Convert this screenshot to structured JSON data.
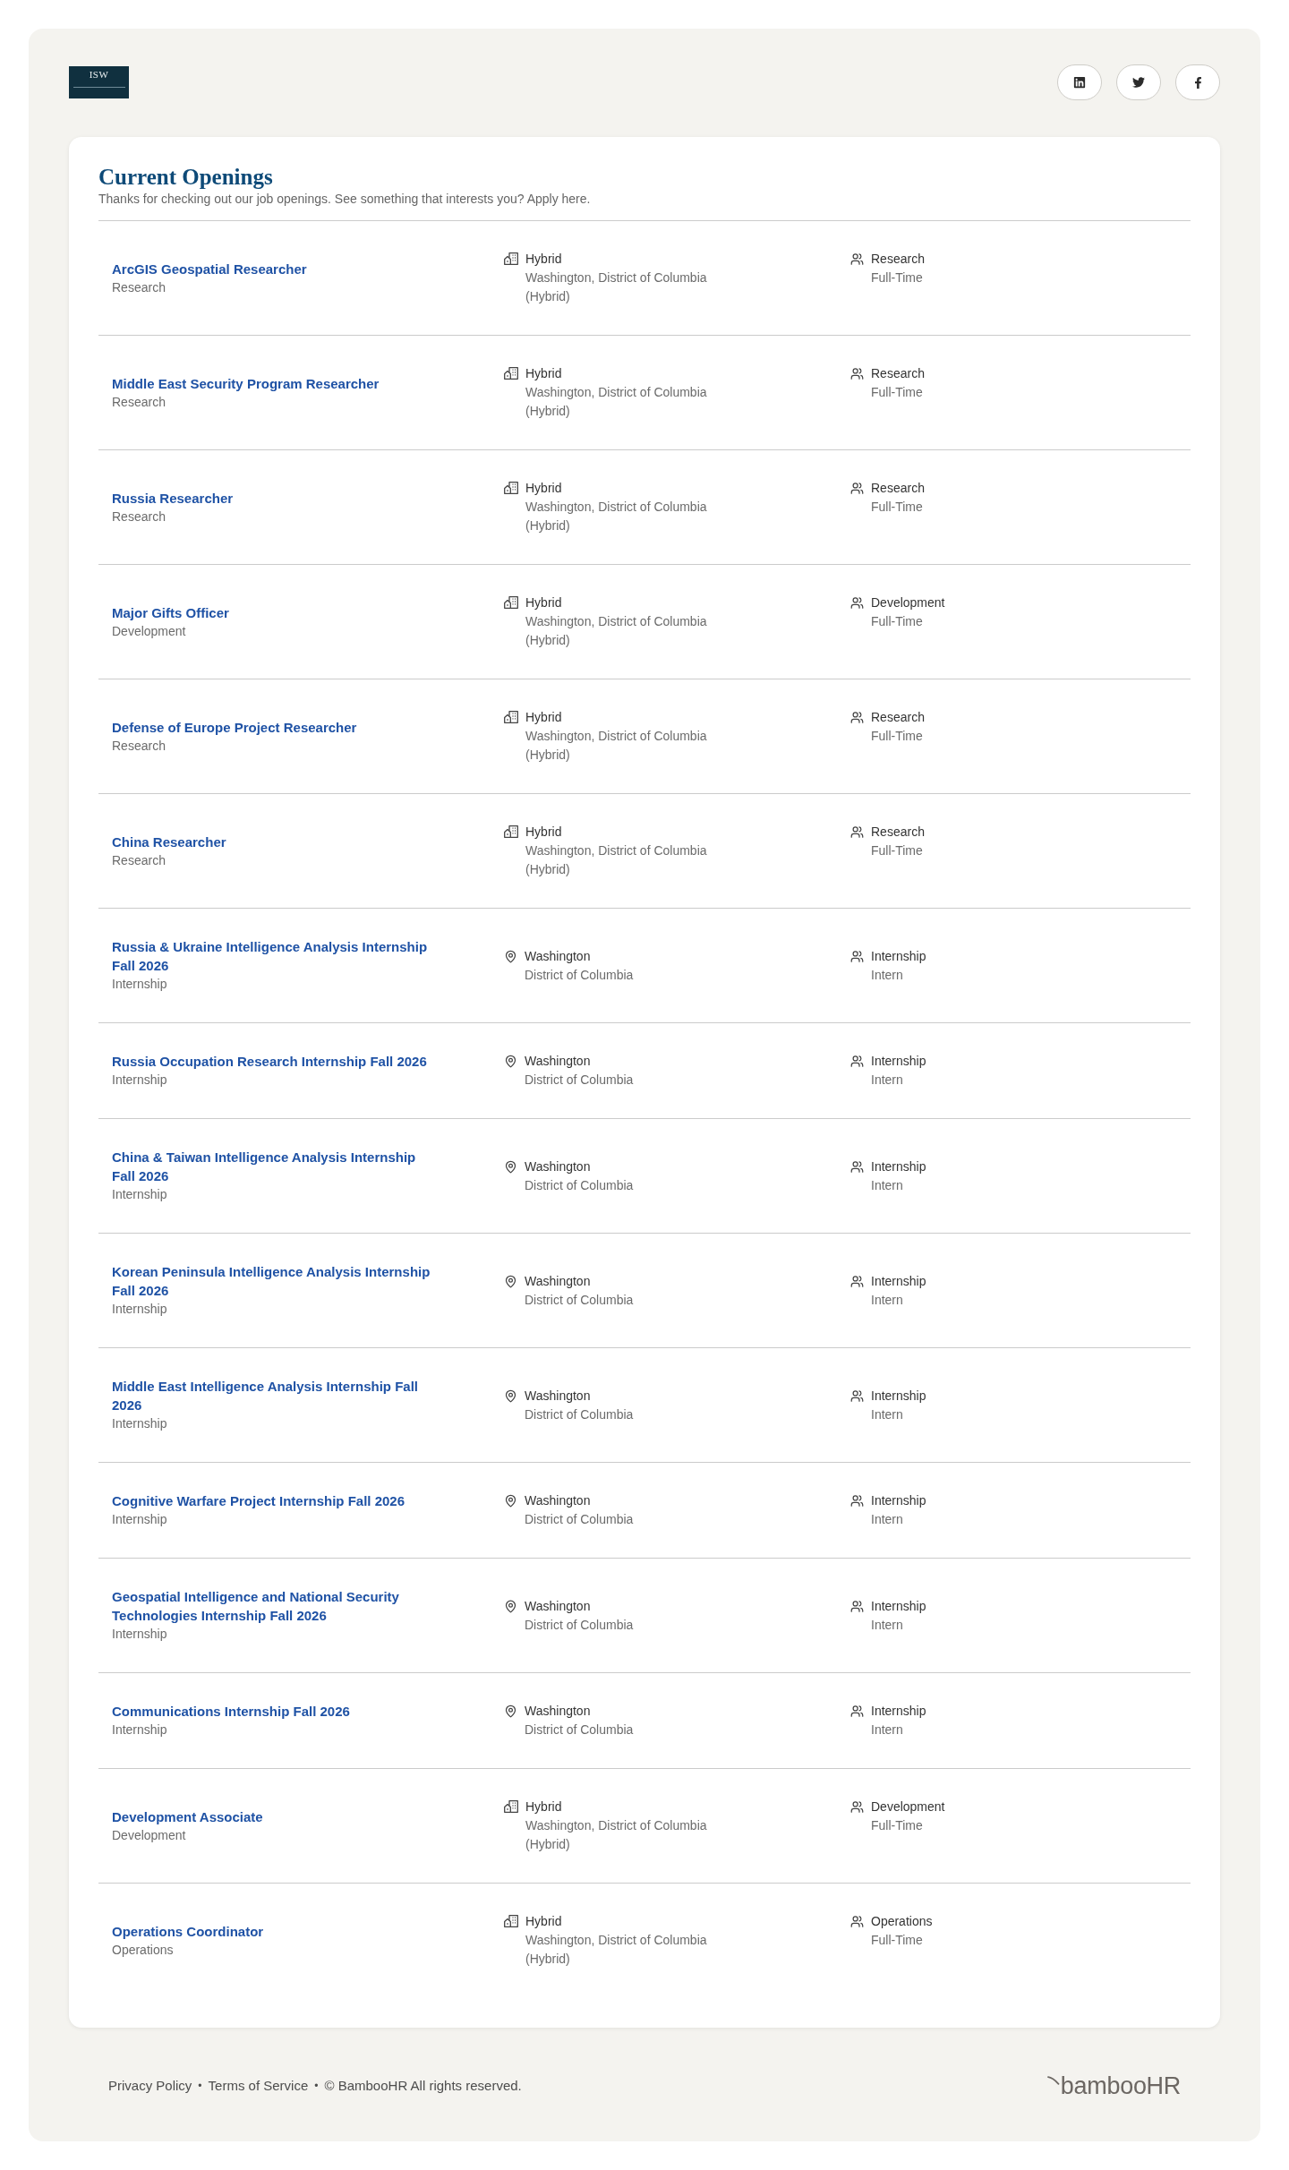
{
  "header": {
    "logo": {
      "text": "ISW"
    },
    "social_links": [
      {
        "kind": "linkedin"
      },
      {
        "kind": "twitter"
      },
      {
        "kind": "facebook"
      }
    ]
  },
  "openings": {
    "title": "Current Openings",
    "subtitle": "Thanks for checking out our job openings. See something that interests you? Apply here.",
    "jobs": [
      {
        "title": "ArcGIS Geospatial Researcher",
        "department": "Research",
        "location": {
          "kind": "hybrid",
          "name": "Hybrid",
          "address": "Washington, District of Columbia",
          "note": "(Hybrid)"
        },
        "category": "Research",
        "type": "Full-Time"
      },
      {
        "title": "Middle East Security Program Researcher",
        "department": "Research",
        "location": {
          "kind": "hybrid",
          "name": "Hybrid",
          "address": "Washington, District of Columbia",
          "note": "(Hybrid)"
        },
        "category": "Research",
        "type": "Full-Time"
      },
      {
        "title": "Russia Researcher",
        "department": "Research",
        "location": {
          "kind": "hybrid",
          "name": "Hybrid",
          "address": "Washington, District of Columbia",
          "note": "(Hybrid)"
        },
        "category": "Research",
        "type": "Full-Time"
      },
      {
        "title": "Major Gifts Officer",
        "department": "Development",
        "location": {
          "kind": "hybrid",
          "name": "Hybrid",
          "address": "Washington, District of Columbia",
          "note": "(Hybrid)"
        },
        "category": "Development",
        "type": "Full-Time"
      },
      {
        "title": "Defense of Europe Project Researcher",
        "department": "Research",
        "location": {
          "kind": "hybrid",
          "name": "Hybrid",
          "address": "Washington, District of Columbia",
          "note": "(Hybrid)"
        },
        "category": "Research",
        "type": "Full-Time"
      },
      {
        "title": "China Researcher",
        "department": "Research",
        "location": {
          "kind": "hybrid",
          "name": "Hybrid",
          "address": "Washington, District of Columbia",
          "note": "(Hybrid)"
        },
        "category": "Research",
        "type": "Full-Time"
      },
      {
        "title": "Russia & Ukraine Intelligence Analysis Internship Fall 2026",
        "department": "Internship",
        "location": {
          "kind": "onsite",
          "name": "Washington",
          "address": "District of Columbia"
        },
        "category": "Internship",
        "type": "Intern"
      },
      {
        "title": "Russia Occupation Research Internship Fall 2026",
        "department": "Internship",
        "location": {
          "kind": "onsite",
          "name": "Washington",
          "address": "District of Columbia"
        },
        "category": "Internship",
        "type": "Intern"
      },
      {
        "title": "China & Taiwan Intelligence Analysis Internship Fall 2026",
        "department": "Internship",
        "location": {
          "kind": "onsite",
          "name": "Washington",
          "address": "District of Columbia"
        },
        "category": "Internship",
        "type": "Intern"
      },
      {
        "title": "Korean Peninsula Intelligence Analysis Internship Fall 2026",
        "department": "Internship",
        "location": {
          "kind": "onsite",
          "name": "Washington",
          "address": "District of Columbia"
        },
        "category": "Internship",
        "type": "Intern"
      },
      {
        "title": "Middle East Intelligence Analysis Internship Fall 2026",
        "department": "Internship",
        "location": {
          "kind": "onsite",
          "name": "Washington",
          "address": "District of Columbia"
        },
        "category": "Internship",
        "type": "Intern"
      },
      {
        "title": "Cognitive Warfare Project Internship Fall 2026",
        "department": "Internship",
        "location": {
          "kind": "onsite",
          "name": "Washington",
          "address": "District of Columbia"
        },
        "category": "Internship",
        "type": "Intern"
      },
      {
        "title": "Geospatial Intelligence and National Security Technologies Internship Fall 2026",
        "department": "Internship",
        "location": {
          "kind": "onsite",
          "name": "Washington",
          "address": "District of Columbia"
        },
        "category": "Internship",
        "type": "Intern"
      },
      {
        "title": "Communications Internship Fall 2026",
        "department": "Internship",
        "location": {
          "kind": "onsite",
          "name": "Washington",
          "address": "District of Columbia"
        },
        "category": "Internship",
        "type": "Intern"
      },
      {
        "title": "Development Associate",
        "department": "Development",
        "location": {
          "kind": "hybrid",
          "name": "Hybrid",
          "address": "Washington, District of Columbia",
          "note": "(Hybrid)"
        },
        "category": "Development",
        "type": "Full-Time"
      },
      {
        "title": "Operations Coordinator",
        "department": "Operations",
        "location": {
          "kind": "hybrid",
          "name": "Hybrid",
          "address": "Washington, District of Columbia",
          "note": "(Hybrid)"
        },
        "category": "Operations",
        "type": "Full-Time"
      }
    ]
  },
  "footer": {
    "items": [
      {
        "kind": "link",
        "text": "Privacy Policy"
      },
      {
        "kind": "separator",
        "text": "•"
      },
      {
        "kind": "link",
        "text": "Terms of Service"
      },
      {
        "kind": "separator",
        "text": "•"
      },
      {
        "kind": "text",
        "text": "© BambooHR All rights reserved."
      }
    ],
    "brand": "bambooHR"
  }
}
